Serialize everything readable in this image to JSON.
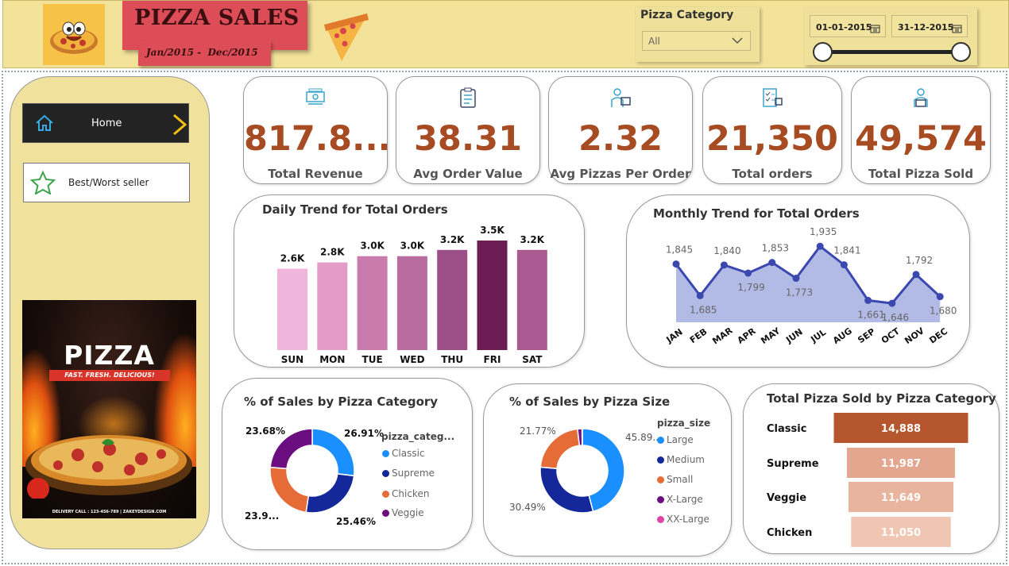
{
  "header": {
    "title": "PIZZA SALES",
    "subtitle": "Jan/2015 -  Dec/2015",
    "category_filter_label": "Pizza Category",
    "category_filter_value": "All",
    "date_start": "01-01-2015",
    "date_end": "31-12-2015"
  },
  "sidebar": {
    "home_label": "Home",
    "best_worst_label": "Best/Worst seller",
    "promo": {
      "title": "PIZZA",
      "tagline": "FAST. FRESH. DELICIOUS!",
      "footer": "DELIVERY CALL : 123-456-789 | ZAKEYDESIGN.COM"
    }
  },
  "kpis": [
    {
      "value": "817.8...",
      "label": "Total Revenue",
      "icon": "money-icon"
    },
    {
      "value": "38.31",
      "label": "Avg Order Value",
      "icon": "clipboard-icon"
    },
    {
      "value": "2.32",
      "label": "Avg Pizzas Per Order",
      "icon": "delivery-person-icon"
    },
    {
      "value": "21,350",
      "label": "Total orders",
      "icon": "order-checklist-icon"
    },
    {
      "value": "49,574",
      "label": "Total Pizza Sold",
      "icon": "delivery-box-icon"
    }
  ],
  "colors": {
    "accent_kpi": "#a64b22",
    "header_bg": "#f2e29a",
    "title_red": "#dc4d57",
    "line_series": "#3a48b0",
    "area_fill": "#aab4e2"
  },
  "chart_data": [
    {
      "type": "bar",
      "title": "Daily Trend for Total Orders",
      "categories": [
        "SUN",
        "MON",
        "TUE",
        "WED",
        "THU",
        "FRI",
        "SAT"
      ],
      "values": [
        2.6,
        2.8,
        3.0,
        3.0,
        3.2,
        3.5,
        3.2
      ],
      "labels": [
        "2.6K",
        "2.8K",
        "3.0K",
        "3.0K",
        "3.2K",
        "3.5K",
        "3.2K"
      ],
      "colors": [
        "#f0b5da",
        "#e39bc8",
        "#c87bac",
        "#b96c9f",
        "#9c4f86",
        "#6b1d54",
        "#a95b91"
      ],
      "ylim": [
        0,
        3.5
      ]
    },
    {
      "type": "area",
      "title": "Monthly Trend for Total Orders",
      "categories": [
        "JAN",
        "FEB",
        "MAR",
        "APR",
        "MAY",
        "JUN",
        "JUL",
        "AUG",
        "SEP",
        "OCT",
        "NOV",
        "DEC"
      ],
      "values": [
        1845,
        1685,
        1840,
        1799,
        1853,
        1773,
        1935,
        1841,
        1661,
        1646,
        1792,
        1680
      ],
      "labels": [
        "1,845",
        "1,685",
        "1,840",
        "1,799",
        "1,853",
        "1,773",
        "1,935",
        "1,841",
        "1,661",
        "1,646",
        "1,792",
        "1,680"
      ],
      "ylim": [
        1550,
        1960
      ]
    },
    {
      "type": "pie",
      "title": "% of Sales by Pizza Category",
      "legend_title": "pizza_categ...",
      "categories": [
        "Classic",
        "Supreme",
        "Chicken",
        "Veggie"
      ],
      "values": [
        26.91,
        25.46,
        23.96,
        23.68
      ],
      "labels": [
        "26.91%",
        "25.46%",
        "23.9...",
        "23.68%"
      ],
      "colors": [
        "#1a8fff",
        "#14289a",
        "#e66c37",
        "#6b0f80"
      ]
    },
    {
      "type": "pie",
      "title": "% of Sales by Pizza Size",
      "legend_title": "pizza_size",
      "categories": [
        "Large",
        "Medium",
        "Small",
        "X-Large",
        "XX-Large"
      ],
      "values": [
        45.89,
        30.49,
        21.77,
        1.72,
        0.12
      ],
      "labels": [
        "45.89...",
        "30.49%",
        "21.77%",
        "",
        ""
      ],
      "colors": [
        "#1a8fff",
        "#14289a",
        "#e66c37",
        "#6b0f80",
        "#e044a7"
      ]
    },
    {
      "type": "bar",
      "title": "Total Pizza Sold by Pizza Category",
      "categories": [
        "Classic",
        "Supreme",
        "Veggie",
        "Chicken"
      ],
      "values": [
        14888,
        11987,
        11649,
        11050
      ],
      "labels": [
        "14,888",
        "11,987",
        "11,649",
        "11,050"
      ],
      "colors": [
        "#b5562e",
        "#e2a78e",
        "#e8b49e",
        "#f0c6b2"
      ]
    }
  ]
}
